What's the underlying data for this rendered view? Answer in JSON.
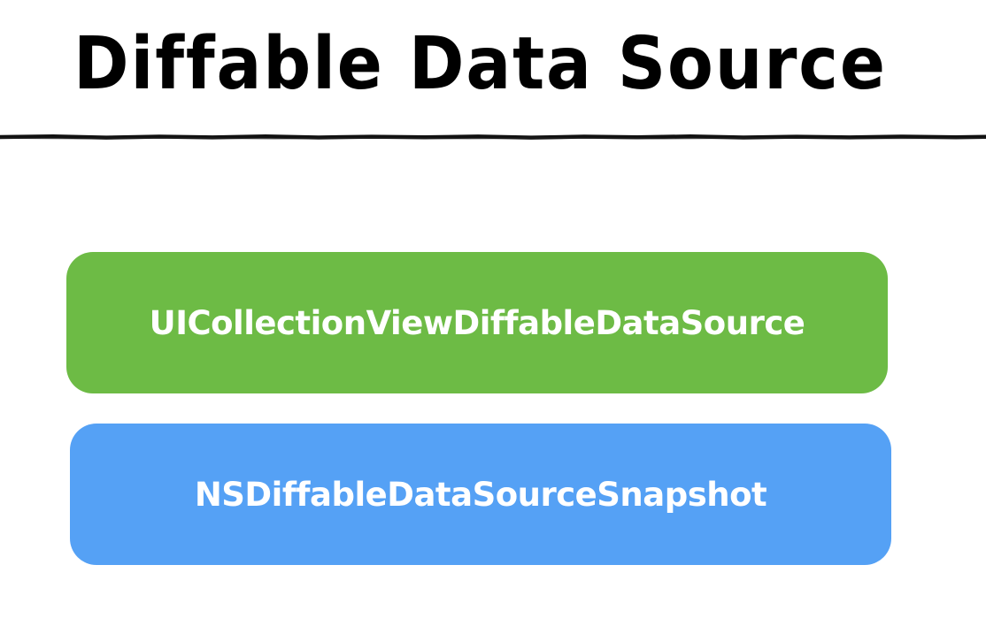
{
  "title": "Diffable Data Source",
  "boxes": [
    {
      "label": "UICollectionViewDiffableDataSource",
      "color": "#6DBB45"
    },
    {
      "label": "NSDiffableDataSourceSnapshot",
      "color": "#55A1F5"
    }
  ],
  "colors": {
    "title": "#000000",
    "divider": "#111111",
    "box_text": "#FFFFFF",
    "background": "#FFFFFF"
  }
}
